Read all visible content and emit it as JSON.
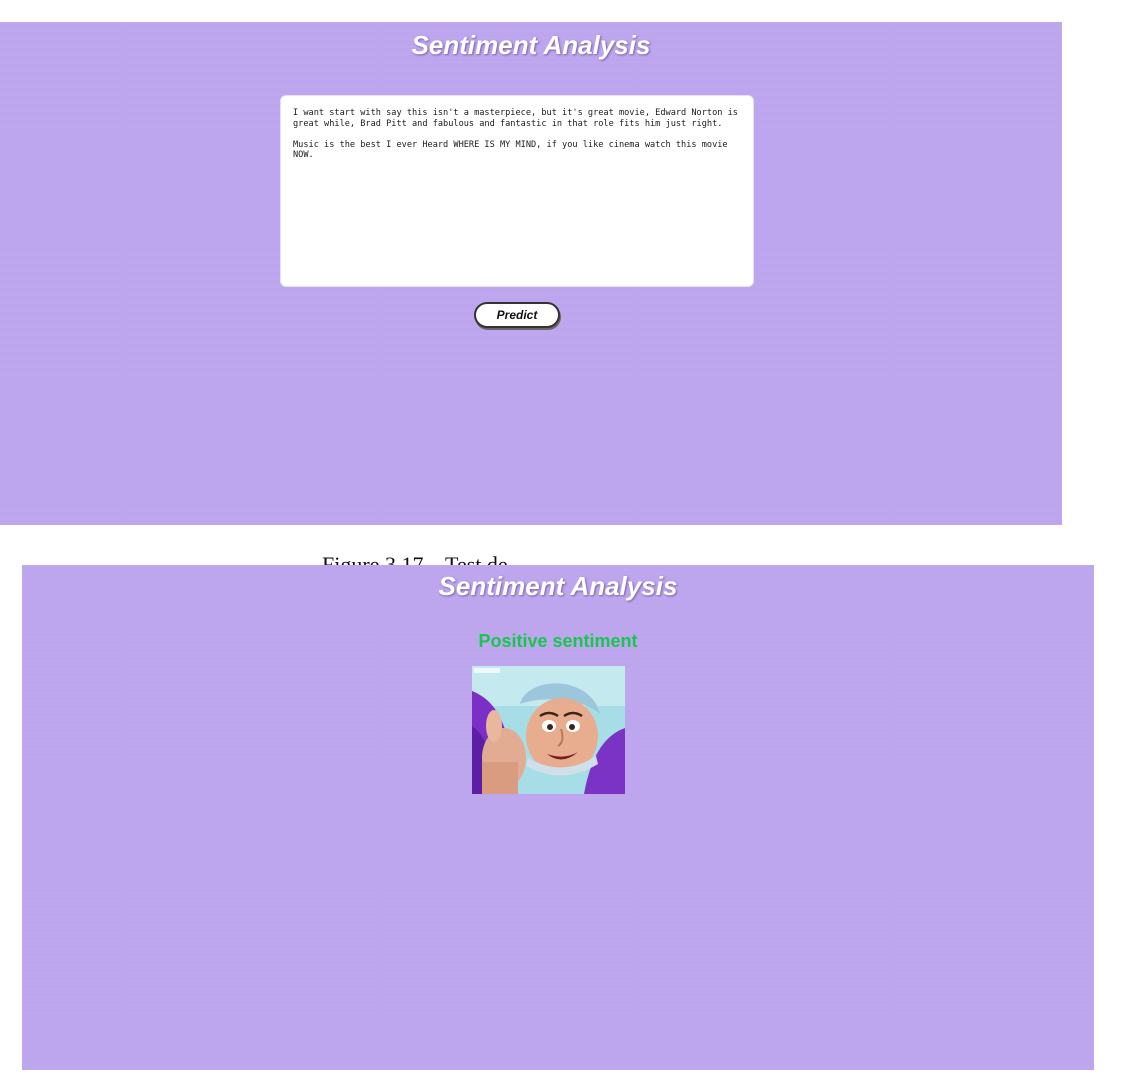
{
  "input_screen": {
    "title": "Sentiment Analysis",
    "review_text": "I want start with say this isn't a masterpiece, but it's great movie, Edward Norton is great while, Brad Pitt and fabulous and fantastic in that role fits him just right.\n\nMusic is the best I ever Heard WHERE IS MY MIND, if you like cinema watch this movie NOW.",
    "predict_label": "Predict"
  },
  "caption_fragment": "Figure 3.17 – Test de",
  "result_screen": {
    "title": "Sentiment Analysis",
    "result_label": "Positive sentiment",
    "result_color": "#18c64e",
    "photo_icon": "man-thumbs-up-photo"
  },
  "colors": {
    "background": "#bda6ee",
    "title_text": "#ffffff",
    "button_border": "#333333"
  }
}
